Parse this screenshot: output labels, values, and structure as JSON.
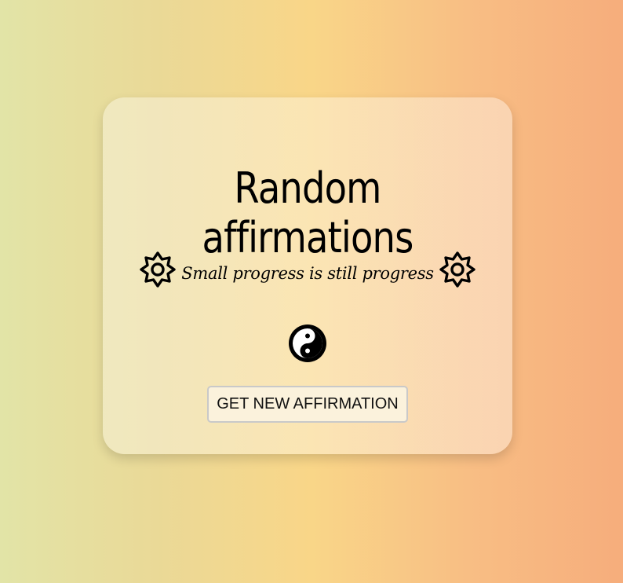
{
  "card": {
    "title": "Random affirmations",
    "affirmation": "Small progress is still progress",
    "button_label": "GET NEW AFFIRMATION"
  },
  "icons": {
    "left": "sun-icon",
    "right": "sun-icon",
    "center": "yin-yang-icon"
  }
}
